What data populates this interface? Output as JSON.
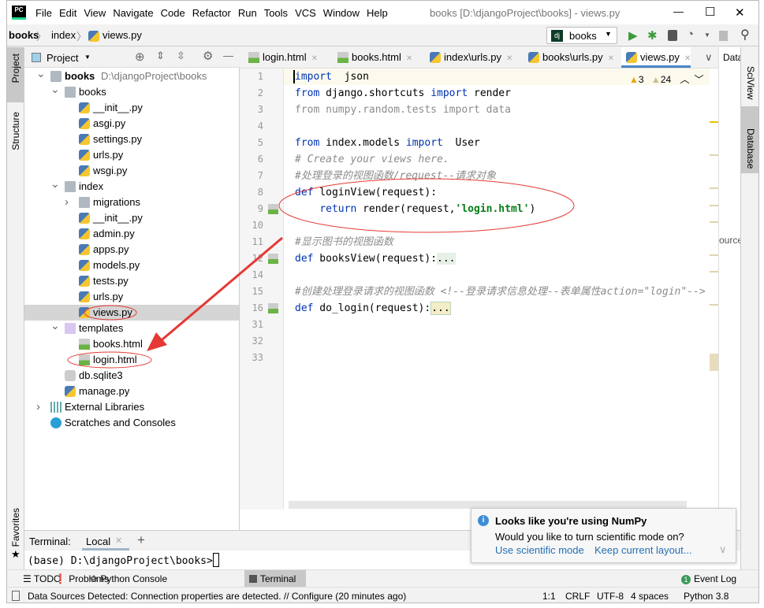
{
  "titlebar": {
    "app_icon": "PC",
    "menus": [
      "File",
      "Edit",
      "View",
      "Navigate",
      "Code",
      "Refactor",
      "Run",
      "Tools",
      "VCS",
      "Window",
      "Help"
    ],
    "title": "books [D:\\djangoProject\\books] - views.py",
    "minimize": "—",
    "maximize": "☐",
    "close": "✕"
  },
  "navbar": {
    "breadcrumb": [
      "books",
      "index",
      "views.py"
    ],
    "run_config": "books",
    "run_config_icon": "dj"
  },
  "left_stripe": {
    "project": "Project",
    "structure": "Structure",
    "favorites": "Favorites"
  },
  "project_panel": {
    "title": "Project",
    "items": [
      {
        "label": "books",
        "path": "D:\\djangoProject\\books",
        "depth": 0,
        "type": "folder",
        "arrow": "open",
        "bold": true
      },
      {
        "label": "books",
        "depth": 1,
        "type": "folder",
        "arrow": "open"
      },
      {
        "label": "__init__.py",
        "depth": 2,
        "type": "py"
      },
      {
        "label": "asgi.py",
        "depth": 2,
        "type": "py"
      },
      {
        "label": "settings.py",
        "depth": 2,
        "type": "py"
      },
      {
        "label": "urls.py",
        "depth": 2,
        "type": "py"
      },
      {
        "label": "wsgi.py",
        "depth": 2,
        "type": "py"
      },
      {
        "label": "index",
        "depth": 1,
        "type": "folder",
        "arrow": "open"
      },
      {
        "label": "migrations",
        "depth": 2,
        "type": "folder",
        "arrow": "closed"
      },
      {
        "label": "__init__.py",
        "depth": 2,
        "type": "py"
      },
      {
        "label": "admin.py",
        "depth": 2,
        "type": "py"
      },
      {
        "label": "apps.py",
        "depth": 2,
        "type": "py"
      },
      {
        "label": "models.py",
        "depth": 2,
        "type": "py"
      },
      {
        "label": "tests.py",
        "depth": 2,
        "type": "py"
      },
      {
        "label": "urls.py",
        "depth": 2,
        "type": "py"
      },
      {
        "label": "views.py",
        "depth": 2,
        "type": "py",
        "selected": true
      },
      {
        "label": "templates",
        "depth": 1,
        "type": "folder-purple",
        "arrow": "open"
      },
      {
        "label": "books.html",
        "depth": 2,
        "type": "html"
      },
      {
        "label": "login.html",
        "depth": 2,
        "type": "html"
      },
      {
        "label": "db.sqlite3",
        "depth": 1,
        "type": "db"
      },
      {
        "label": "manage.py",
        "depth": 1,
        "type": "py"
      },
      {
        "label": "External Libraries",
        "depth": 0,
        "type": "lib",
        "arrow": "closed"
      },
      {
        "label": "Scratches and Consoles",
        "depth": 0,
        "type": "scratch"
      }
    ]
  },
  "editor": {
    "tabs": [
      {
        "label": "login.html",
        "icon": "html"
      },
      {
        "label": "books.html",
        "icon": "html"
      },
      {
        "label": "index\\urls.py",
        "icon": "py"
      },
      {
        "label": "books\\urls.py",
        "icon": "py"
      },
      {
        "label": "views.py",
        "icon": "py",
        "active": true
      }
    ],
    "inspections": {
      "warnings": "3",
      "weak_warnings": "24"
    },
    "lines": [
      {
        "n": "1",
        "t": [
          [
            "kw",
            "import"
          ],
          [
            "",
            "  json"
          ]
        ]
      },
      {
        "n": "2",
        "t": [
          [
            "kw",
            "from"
          ],
          [
            "",
            " django.shortcuts "
          ],
          [
            "kw",
            "import"
          ],
          [
            "",
            " render"
          ]
        ]
      },
      {
        "n": "3",
        "t": [
          [
            "dim",
            "from numpy.random.tests import data"
          ]
        ]
      },
      {
        "n": "4",
        "t": []
      },
      {
        "n": "5",
        "t": [
          [
            "kw",
            "from"
          ],
          [
            "",
            " index.models "
          ],
          [
            "kw",
            "import"
          ],
          [
            "",
            "  User"
          ]
        ]
      },
      {
        "n": "6",
        "t": [
          [
            "cm",
            "# Create your views here."
          ]
        ]
      },
      {
        "n": "7",
        "t": [
          [
            "cm",
            "#处理登录的视图函数/request--请求对象"
          ]
        ]
      },
      {
        "n": "8",
        "t": [
          [
            "kw",
            "def"
          ],
          [
            "",
            " loginView(request):"
          ]
        ]
      },
      {
        "n": "9",
        "t": [
          [
            "",
            "    "
          ],
          [
            "kw",
            "return"
          ],
          [
            "",
            " render(request,"
          ],
          [
            "str",
            "'login.html'"
          ],
          [
            "",
            ")"
          ]
        ]
      },
      {
        "n": "10",
        "t": []
      },
      {
        "n": "11",
        "t": [
          [
            "cm",
            "#显示图书的视图函数"
          ]
        ]
      },
      {
        "n": "12",
        "t": [
          [
            "kw",
            "def"
          ],
          [
            "",
            " booksView(request):"
          ],
          [
            "fold",
            "..."
          ]
        ]
      },
      {
        "n": "14",
        "t": []
      },
      {
        "n": "15",
        "t": [
          [
            "cm",
            "#创建处理登录请求的视图函数 <!--登录请求信息处理--表单属性action=\"login\"-->"
          ]
        ]
      },
      {
        "n": "16",
        "t": [
          [
            "kw",
            "def"
          ],
          [
            "",
            " do_login(request):"
          ],
          [
            "fold2",
            "..."
          ]
        ]
      },
      {
        "n": "31",
        "t": []
      },
      {
        "n": "32",
        "t": []
      },
      {
        "n": "33",
        "t": []
      }
    ]
  },
  "right_stripe": {
    "data_tab": "Data",
    "sciview": "SciView",
    "database": "Database",
    "clipped": "ource"
  },
  "terminal": {
    "label": "Terminal:",
    "tab": "Local",
    "add": "+",
    "prompt": "(base) D:\\djangoProject\\books>"
  },
  "notification": {
    "title": "Looks like you're using NumPy",
    "body": "Would you like to turn scientific mode on?",
    "action1": "Use scientific mode",
    "action2": "Keep current layout..."
  },
  "toolwindows": [
    "TODO",
    "Problems",
    "Python Console",
    "Terminal"
  ],
  "event_log": {
    "badge": "1",
    "label": "Event Log"
  },
  "status": {
    "message": "Data Sources Detected: Connection properties are detected. // Configure (20 minutes ago)",
    "position": "1:1",
    "line_sep": "CRLF",
    "encoding": "UTF-8",
    "indent": "4 spaces",
    "interpreter": "Python 3.8"
  }
}
